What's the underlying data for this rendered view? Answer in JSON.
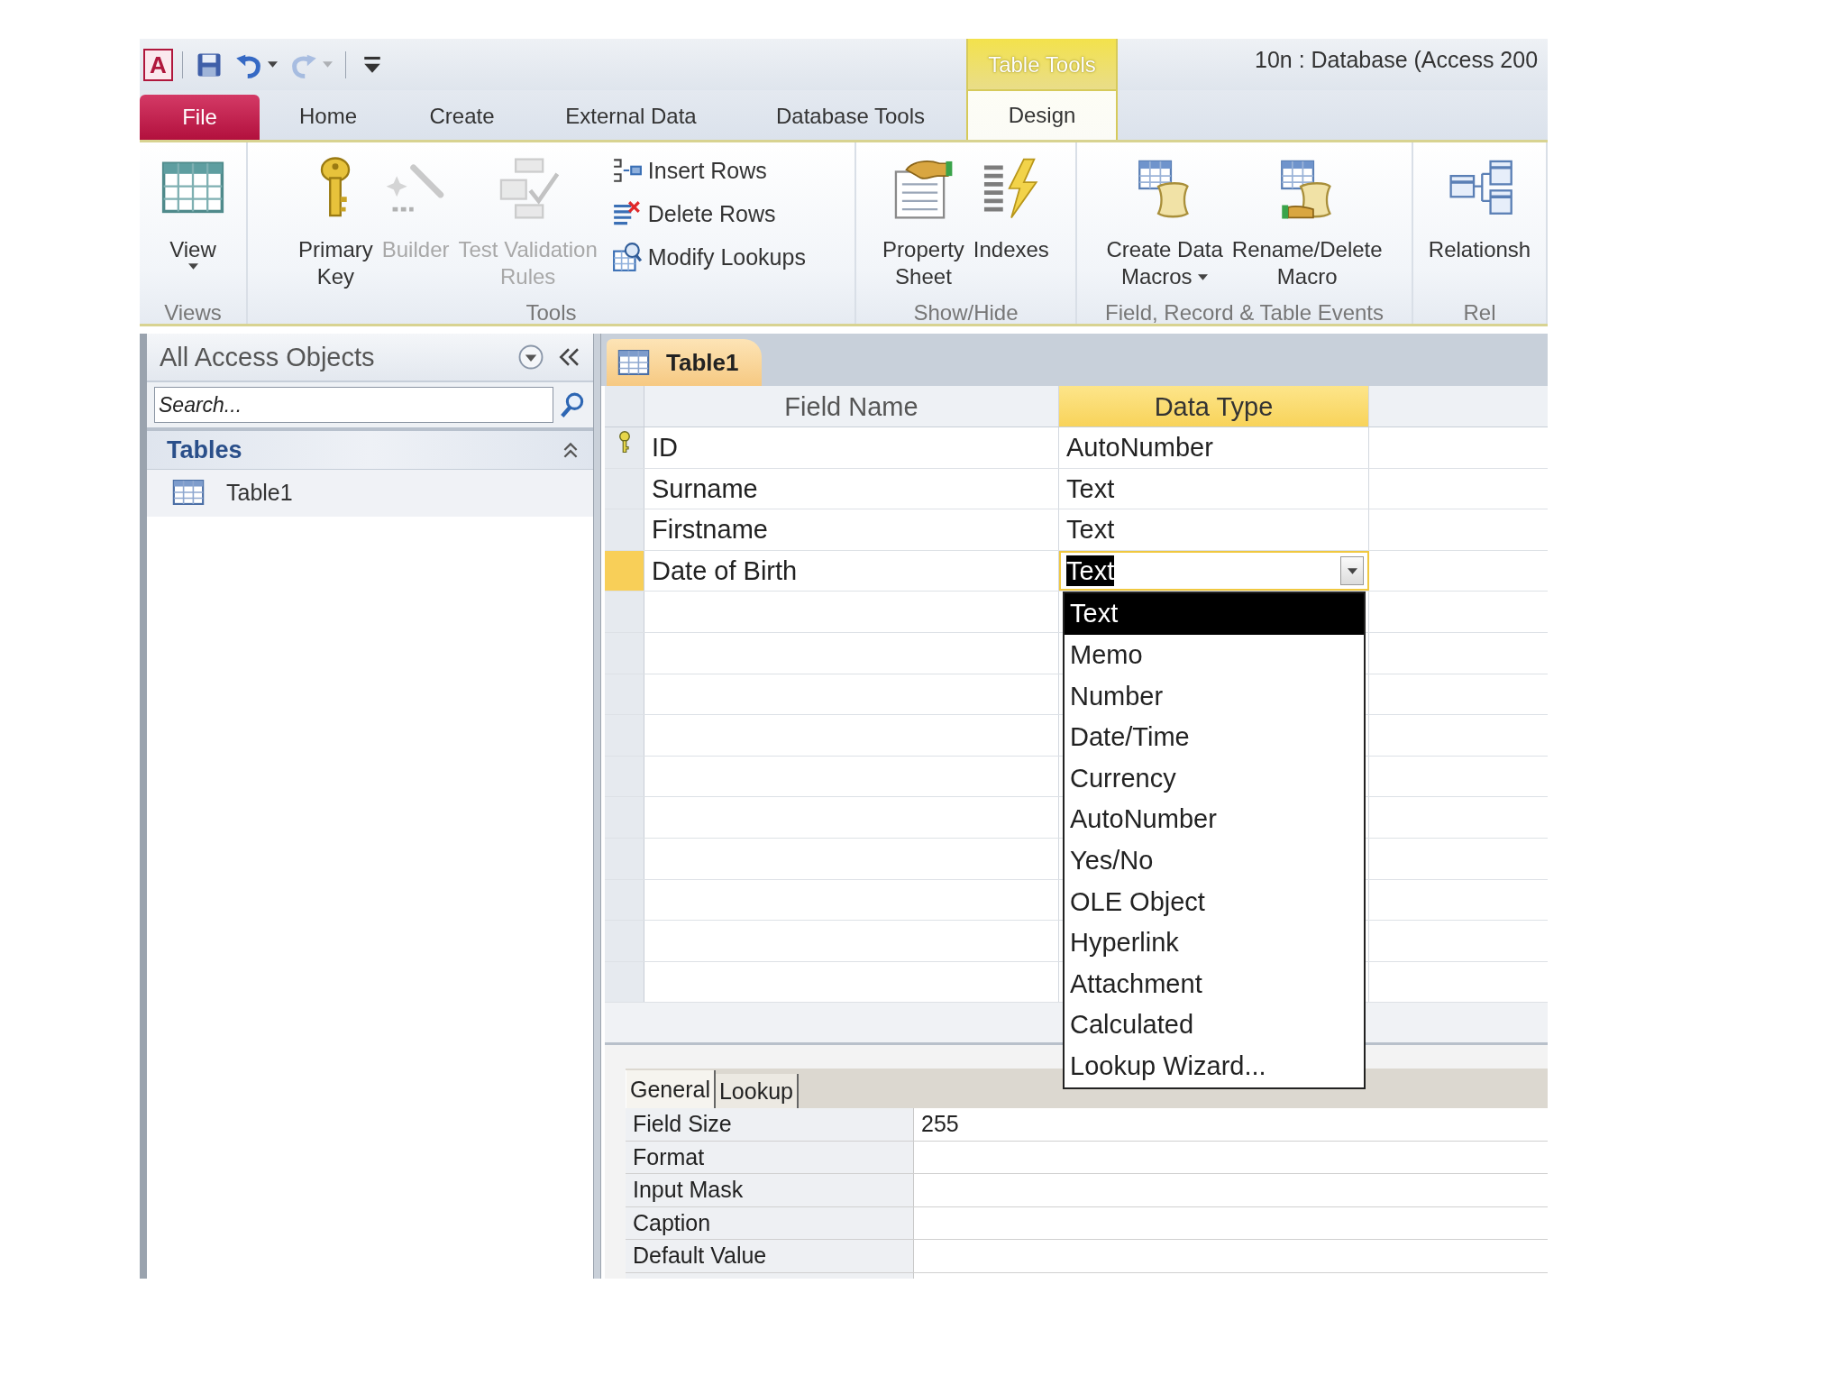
{
  "window": {
    "app_letter": "A",
    "context_tab": "Table Tools",
    "title": "10n : Database (Access 200"
  },
  "quick_access": [
    {
      "kind": "save",
      "disabled": false,
      "dropdown": false
    },
    {
      "kind": "undo",
      "disabled": false,
      "dropdown": true
    },
    {
      "kind": "redo",
      "disabled": true,
      "dropdown": true
    },
    {
      "kind": "customize",
      "disabled": false,
      "dropdown": false
    }
  ],
  "tabs": [
    {
      "label": "File",
      "kind": "menu",
      "selected": false
    },
    {
      "label": "Home",
      "kind": "tab",
      "selected": false
    },
    {
      "label": "Create",
      "kind": "tab",
      "selected": false
    },
    {
      "label": "External Data",
      "kind": "tab",
      "selected": false
    },
    {
      "label": "Database Tools",
      "kind": "tab",
      "selected": false
    },
    {
      "label": "Design",
      "kind": "tab",
      "selected": true
    }
  ],
  "ribbon": {
    "groups": [
      {
        "label": "Views",
        "buttons": [
          {
            "kind": "large",
            "lines": [
              "View"
            ],
            "disabled": false,
            "dropdown": true
          }
        ]
      },
      {
        "label": "Tools",
        "buttons": [
          {
            "kind": "large",
            "lines": [
              "Primary",
              "Key"
            ],
            "disabled": false,
            "dropdown": false
          },
          {
            "kind": "large",
            "lines": [
              "Builder"
            ],
            "disabled": true,
            "dropdown": false
          },
          {
            "kind": "large",
            "lines": [
              "Test Validation",
              "Rules"
            ],
            "disabled": true,
            "dropdown": false
          },
          {
            "kind": "small",
            "lines": [
              "Insert Rows"
            ],
            "disabled": false,
            "dropdown": false
          },
          {
            "kind": "small",
            "lines": [
              "Delete Rows"
            ],
            "disabled": false,
            "dropdown": false
          },
          {
            "kind": "small",
            "lines": [
              "Modify Lookups"
            ],
            "disabled": false,
            "dropdown": false
          }
        ]
      },
      {
        "label": "Show/Hide",
        "buttons": [
          {
            "kind": "large",
            "lines": [
              "Property",
              "Sheet"
            ],
            "disabled": false,
            "dropdown": false
          },
          {
            "kind": "large",
            "lines": [
              "Indexes"
            ],
            "disabled": false,
            "dropdown": false
          }
        ]
      },
      {
        "label": "Field, Record & Table Events",
        "buttons": [
          {
            "kind": "large",
            "lines": [
              "Create Data",
              "Macros"
            ],
            "disabled": false,
            "dropdown": true
          },
          {
            "kind": "large",
            "lines": [
              "Rename/Delete",
              "Macro"
            ],
            "disabled": false,
            "dropdown": false
          }
        ]
      },
      {
        "label": "Rel",
        "buttons": [
          {
            "kind": "large",
            "lines": [
              "Relationsh"
            ],
            "disabled": false,
            "dropdown": false
          }
        ]
      }
    ]
  },
  "navigation_pane": {
    "title": "All Access Objects",
    "search": {
      "placeholder": "Search..."
    },
    "groups": [
      {
        "label": "Tables",
        "expanded": true,
        "items": [
          {
            "label": "Table1"
          }
        ]
      }
    ]
  },
  "document_tabs": [
    {
      "label": "Table1",
      "selected": true
    }
  ],
  "design_grid": {
    "columns": [
      {
        "label": "Field Name",
        "selected": false
      },
      {
        "label": "Data Type",
        "selected": true
      }
    ],
    "rows": [
      {
        "field_name": "ID",
        "data_type": "AutoNumber",
        "primary_key": true,
        "current": false
      },
      {
        "field_name": "Surname",
        "data_type": "Text",
        "primary_key": false,
        "current": false
      },
      {
        "field_name": "Firstname",
        "data_type": "Text",
        "primary_key": false,
        "current": false
      },
      {
        "field_name": "Date of Birth",
        "data_type": "Text",
        "primary_key": false,
        "current": true
      }
    ]
  },
  "data_type_dropdown": {
    "options": [
      {
        "label": "Text",
        "selected": true
      },
      {
        "label": "Memo",
        "selected": false
      },
      {
        "label": "Number",
        "selected": false
      },
      {
        "label": "Date/Time",
        "selected": false
      },
      {
        "label": "Currency",
        "selected": false
      },
      {
        "label": "AutoNumber",
        "selected": false
      },
      {
        "label": "Yes/No",
        "selected": false
      },
      {
        "label": "OLE Object",
        "selected": false
      },
      {
        "label": "Hyperlink",
        "selected": false
      },
      {
        "label": "Attachment",
        "selected": false
      },
      {
        "label": "Calculated",
        "selected": false
      },
      {
        "label": "Lookup Wizard...",
        "selected": false
      }
    ]
  },
  "field_properties": {
    "tabs": [
      {
        "label": "General",
        "selected": true
      },
      {
        "label": "Lookup",
        "selected": false
      }
    ],
    "rows": [
      {
        "label": "Field Size",
        "value": "255"
      },
      {
        "label": "Format"
      },
      {
        "label": "Input Mask"
      },
      {
        "label": "Caption"
      },
      {
        "label": "Default Value"
      }
    ]
  }
}
